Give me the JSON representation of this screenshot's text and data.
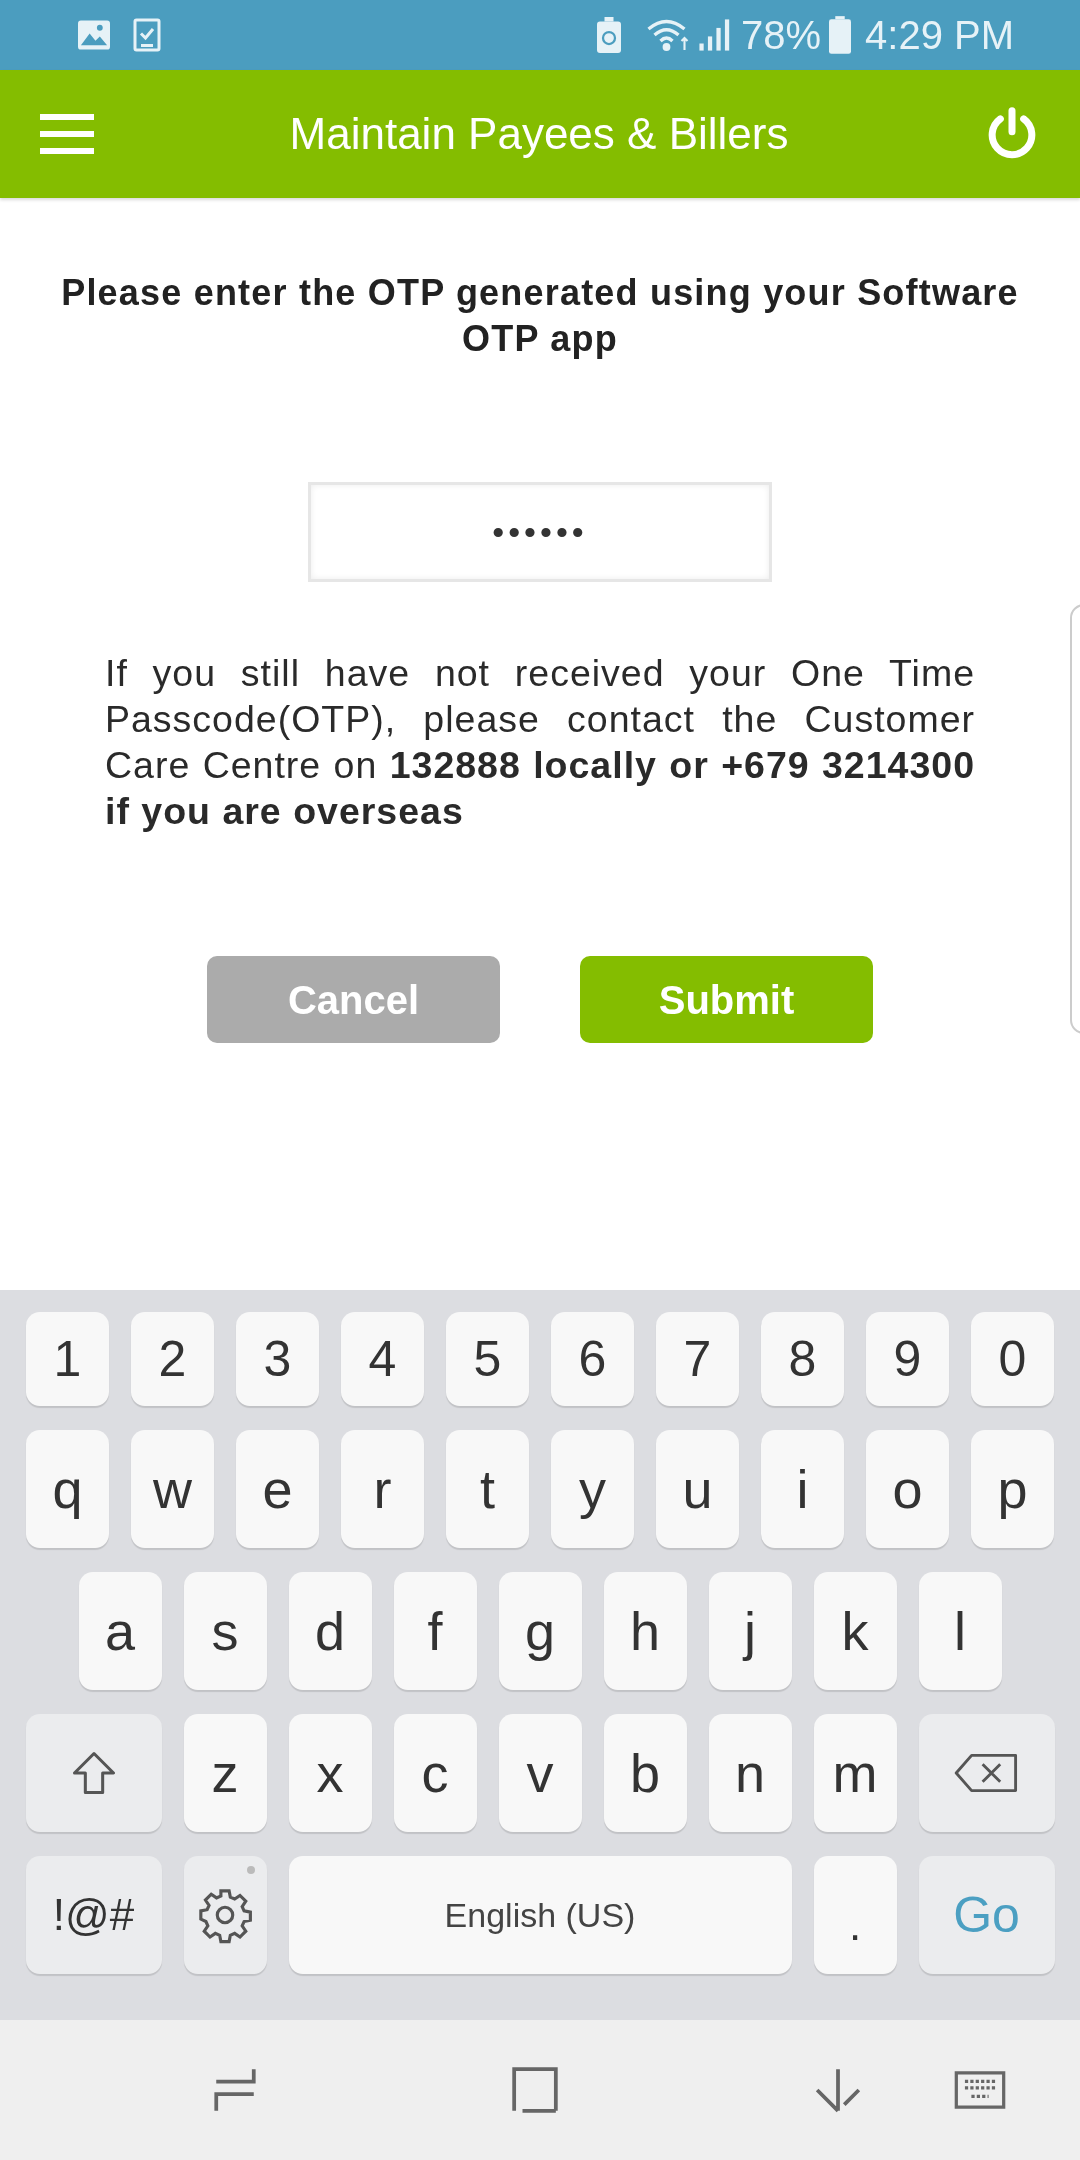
{
  "status_bar": {
    "battery": "78%",
    "time": "4:29 PM"
  },
  "header": {
    "title": "Maintain Payees & Billers"
  },
  "prompt": "Please enter the OTP generated using your Software OTP app",
  "otp_field": {
    "value": "••••••"
  },
  "help_text": "If you still have not received your One Time Passcode(OTP), please contact the Customer Care Centre on **132888 locally or +679 3214300 if you are overseas**",
  "buttons": [
    {
      "label": "Cancel",
      "kind": "secondary"
    },
    {
      "label": "Submit",
      "kind": "primary"
    }
  ],
  "keyboard": {
    "rows": [
      [
        {
          "kind": "digit",
          "label": "1"
        },
        {
          "kind": "digit",
          "label": "2"
        },
        {
          "kind": "digit",
          "label": "3"
        },
        {
          "kind": "digit",
          "label": "4"
        },
        {
          "kind": "digit",
          "label": "5"
        },
        {
          "kind": "digit",
          "label": "6"
        },
        {
          "kind": "digit",
          "label": "7"
        },
        {
          "kind": "digit",
          "label": "8"
        },
        {
          "kind": "digit",
          "label": "9"
        },
        {
          "kind": "digit",
          "label": "0"
        }
      ],
      [
        {
          "kind": "char",
          "label": "q"
        },
        {
          "kind": "char",
          "label": "w"
        },
        {
          "kind": "char",
          "label": "e"
        },
        {
          "kind": "char",
          "label": "r"
        },
        {
          "kind": "char",
          "label": "t"
        },
        {
          "kind": "char",
          "label": "y"
        },
        {
          "kind": "char",
          "label": "u"
        },
        {
          "kind": "char",
          "label": "i"
        },
        {
          "kind": "char",
          "label": "o"
        },
        {
          "kind": "char",
          "label": "p"
        }
      ],
      [
        {
          "kind": "char",
          "label": "a"
        },
        {
          "kind": "char",
          "label": "s"
        },
        {
          "kind": "char",
          "label": "d"
        },
        {
          "kind": "char",
          "label": "f"
        },
        {
          "kind": "char",
          "label": "g"
        },
        {
          "kind": "char",
          "label": "h"
        },
        {
          "kind": "char",
          "label": "j"
        },
        {
          "kind": "char",
          "label": "k"
        },
        {
          "kind": "char",
          "label": "l"
        }
      ],
      [
        {
          "kind": "shift"
        },
        {
          "kind": "char",
          "label": "z"
        },
        {
          "kind": "char",
          "label": "x"
        },
        {
          "kind": "char",
          "label": "c"
        },
        {
          "kind": "char",
          "label": "v"
        },
        {
          "kind": "char",
          "label": "b"
        },
        {
          "kind": "char",
          "label": "n"
        },
        {
          "kind": "char",
          "label": "m"
        },
        {
          "kind": "backspace"
        }
      ]
    ],
    "bottom_row": [
      {
        "kind": "symbols",
        "label": "!@#"
      },
      {
        "kind": "settings"
      },
      {
        "kind": "space",
        "label": "English (US)"
      },
      {
        "kind": "period",
        "label": "."
      },
      {
        "kind": "go",
        "label": "Go"
      }
    ]
  }
}
